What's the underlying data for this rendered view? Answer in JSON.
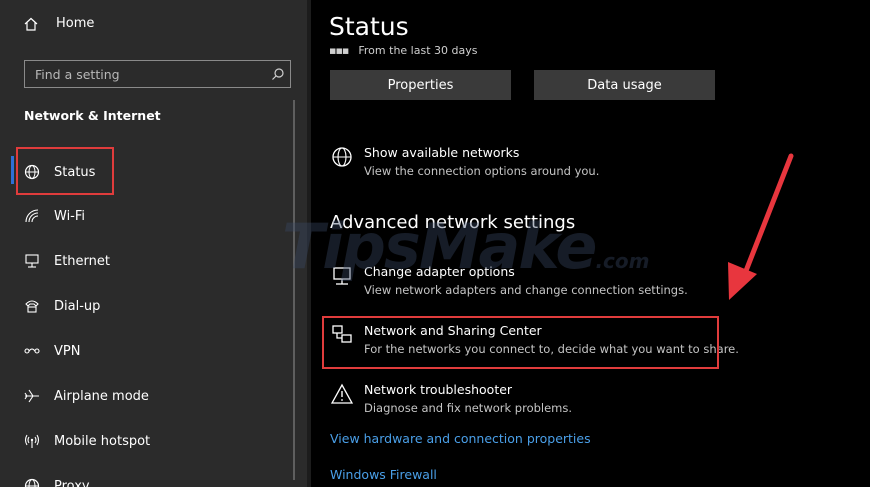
{
  "sidebar": {
    "home_label": "Home",
    "search_placeholder": "Find a setting",
    "section_title": "Network & Internet",
    "items": [
      {
        "label": "Status",
        "icon": "globe-icon"
      },
      {
        "label": "Wi-Fi",
        "icon": "wifi-icon"
      },
      {
        "label": "Ethernet",
        "icon": "ethernet-icon"
      },
      {
        "label": "Dial-up",
        "icon": "dialup-icon"
      },
      {
        "label": "VPN",
        "icon": "vpn-icon"
      },
      {
        "label": "Airplane mode",
        "icon": "airplane-icon"
      },
      {
        "label": "Mobile hotspot",
        "icon": "hotspot-icon"
      },
      {
        "label": "Proxy",
        "icon": "globe-icon"
      }
    ]
  },
  "main": {
    "title": "Status",
    "partial_text": "From the last 30 days",
    "buttons": {
      "properties": "Properties",
      "data_usage": "Data usage"
    },
    "show_networks": {
      "title": "Show available networks",
      "subtitle": "View the connection options around you."
    },
    "advanced_title": "Advanced network settings",
    "options": [
      {
        "title": "Change adapter options",
        "subtitle": "View network adapters and change connection settings."
      },
      {
        "title": "Network and Sharing Center",
        "subtitle": "For the networks you connect to, decide what you want to share."
      },
      {
        "title": "Network troubleshooter",
        "subtitle": "Diagnose and fix network problems."
      }
    ],
    "links": {
      "hardware": "View hardware and connection properties",
      "firewall": "Windows Firewall"
    }
  },
  "watermark": {
    "text": "TipsMake",
    "suffix": ".com"
  },
  "colors": {
    "sidebar_bg": "#2b2b2b",
    "main_bg": "#000000",
    "accent": "#2f6fd6",
    "highlight": "#e03c3c",
    "link": "#4a9fe8"
  }
}
